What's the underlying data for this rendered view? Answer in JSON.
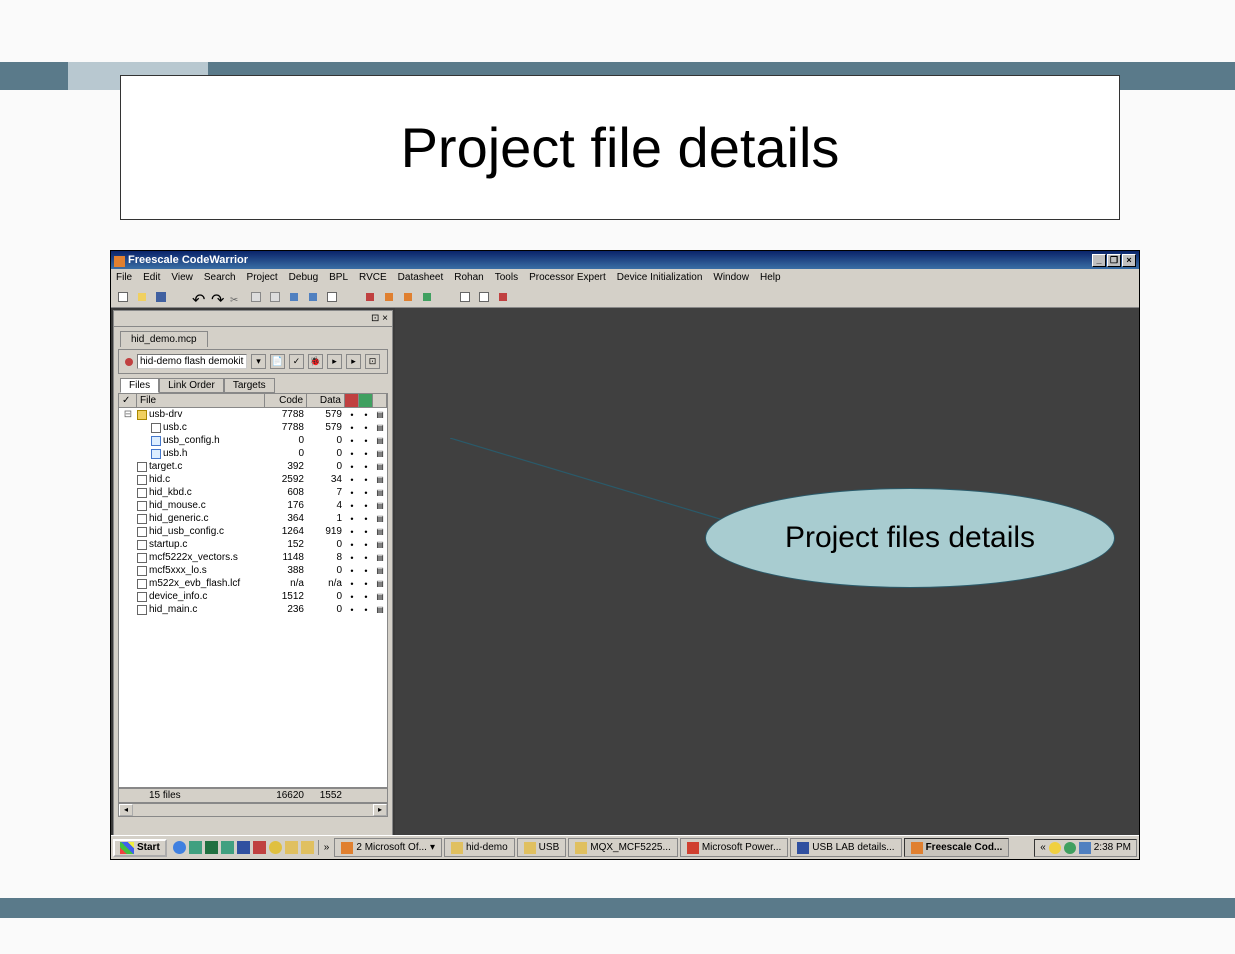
{
  "slide": {
    "title": "Project file details"
  },
  "app": {
    "title": "Freescale CodeWarrior",
    "menu": [
      "File",
      "Edit",
      "View",
      "Search",
      "Project",
      "Debug",
      "BPL",
      "RVCE",
      "Datasheet",
      "Rohan",
      "Tools",
      "Processor Expert",
      "Device Initialization",
      "Window",
      "Help"
    ]
  },
  "project": {
    "tab": "hid_demo.mcp",
    "target": "hid-demo flash demokit",
    "viewtabs": {
      "files": "Files",
      "link": "Link Order",
      "targets": "Targets"
    },
    "cols": {
      "file": "File",
      "code": "Code",
      "data": "Data"
    },
    "rows": [
      {
        "name": "usb-drv",
        "code": "7788",
        "data": "579",
        "type": "folder",
        "indent": 0,
        "exp": "⊟"
      },
      {
        "name": "usb.c",
        "code": "7788",
        "data": "579",
        "type": "c",
        "indent": 1
      },
      {
        "name": "usb_config.h",
        "code": "0",
        "data": "0",
        "type": "h",
        "indent": 1
      },
      {
        "name": "usb.h",
        "code": "0",
        "data": "0",
        "type": "h",
        "indent": 1
      },
      {
        "name": "target.c",
        "code": "392",
        "data": "0",
        "type": "c",
        "indent": 0
      },
      {
        "name": "hid.c",
        "code": "2592",
        "data": "34",
        "type": "c",
        "indent": 0
      },
      {
        "name": "hid_kbd.c",
        "code": "608",
        "data": "7",
        "type": "c",
        "indent": 0
      },
      {
        "name": "hid_mouse.c",
        "code": "176",
        "data": "4",
        "type": "c",
        "indent": 0
      },
      {
        "name": "hid_generic.c",
        "code": "364",
        "data": "1",
        "type": "c",
        "indent": 0
      },
      {
        "name": "hid_usb_config.c",
        "code": "1264",
        "data": "919",
        "type": "c",
        "indent": 0
      },
      {
        "name": "startup.c",
        "code": "152",
        "data": "0",
        "type": "c",
        "indent": 0
      },
      {
        "name": "mcf5222x_vectors.s",
        "code": "1148",
        "data": "8",
        "type": "c",
        "indent": 0
      },
      {
        "name": "mcf5xxx_lo.s",
        "code": "388",
        "data": "0",
        "type": "c",
        "indent": 0
      },
      {
        "name": "m522x_evb_flash.lcf",
        "code": "n/a",
        "data": "n/a",
        "type": "c",
        "indent": 0
      },
      {
        "name": "device_info.c",
        "code": "1512",
        "data": "0",
        "type": "c",
        "indent": 0
      },
      {
        "name": "hid_main.c",
        "code": "236",
        "data": "0",
        "type": "c",
        "indent": 0
      }
    ],
    "footer": {
      "count": "15 files",
      "code": "16620",
      "data": "1552"
    }
  },
  "callout": {
    "text": "Project files details"
  },
  "taskbar": {
    "start": "Start",
    "items": [
      {
        "label": "2 Microsoft Of...",
        "icon": "of",
        "grouped": true
      },
      {
        "label": "hid-demo",
        "icon": "fd"
      },
      {
        "label": "USB",
        "icon": "fd"
      },
      {
        "label": "MQX_MCF5225...",
        "icon": "fd"
      },
      {
        "label": "Microsoft Power...",
        "icon": "pp"
      },
      {
        "label": "USB LAB details...",
        "icon": "wd"
      },
      {
        "label": "Freescale Cod...",
        "icon": "cw",
        "active": true
      }
    ],
    "chevron": "»",
    "tray_chevron": "«",
    "time": "2:38 PM"
  }
}
